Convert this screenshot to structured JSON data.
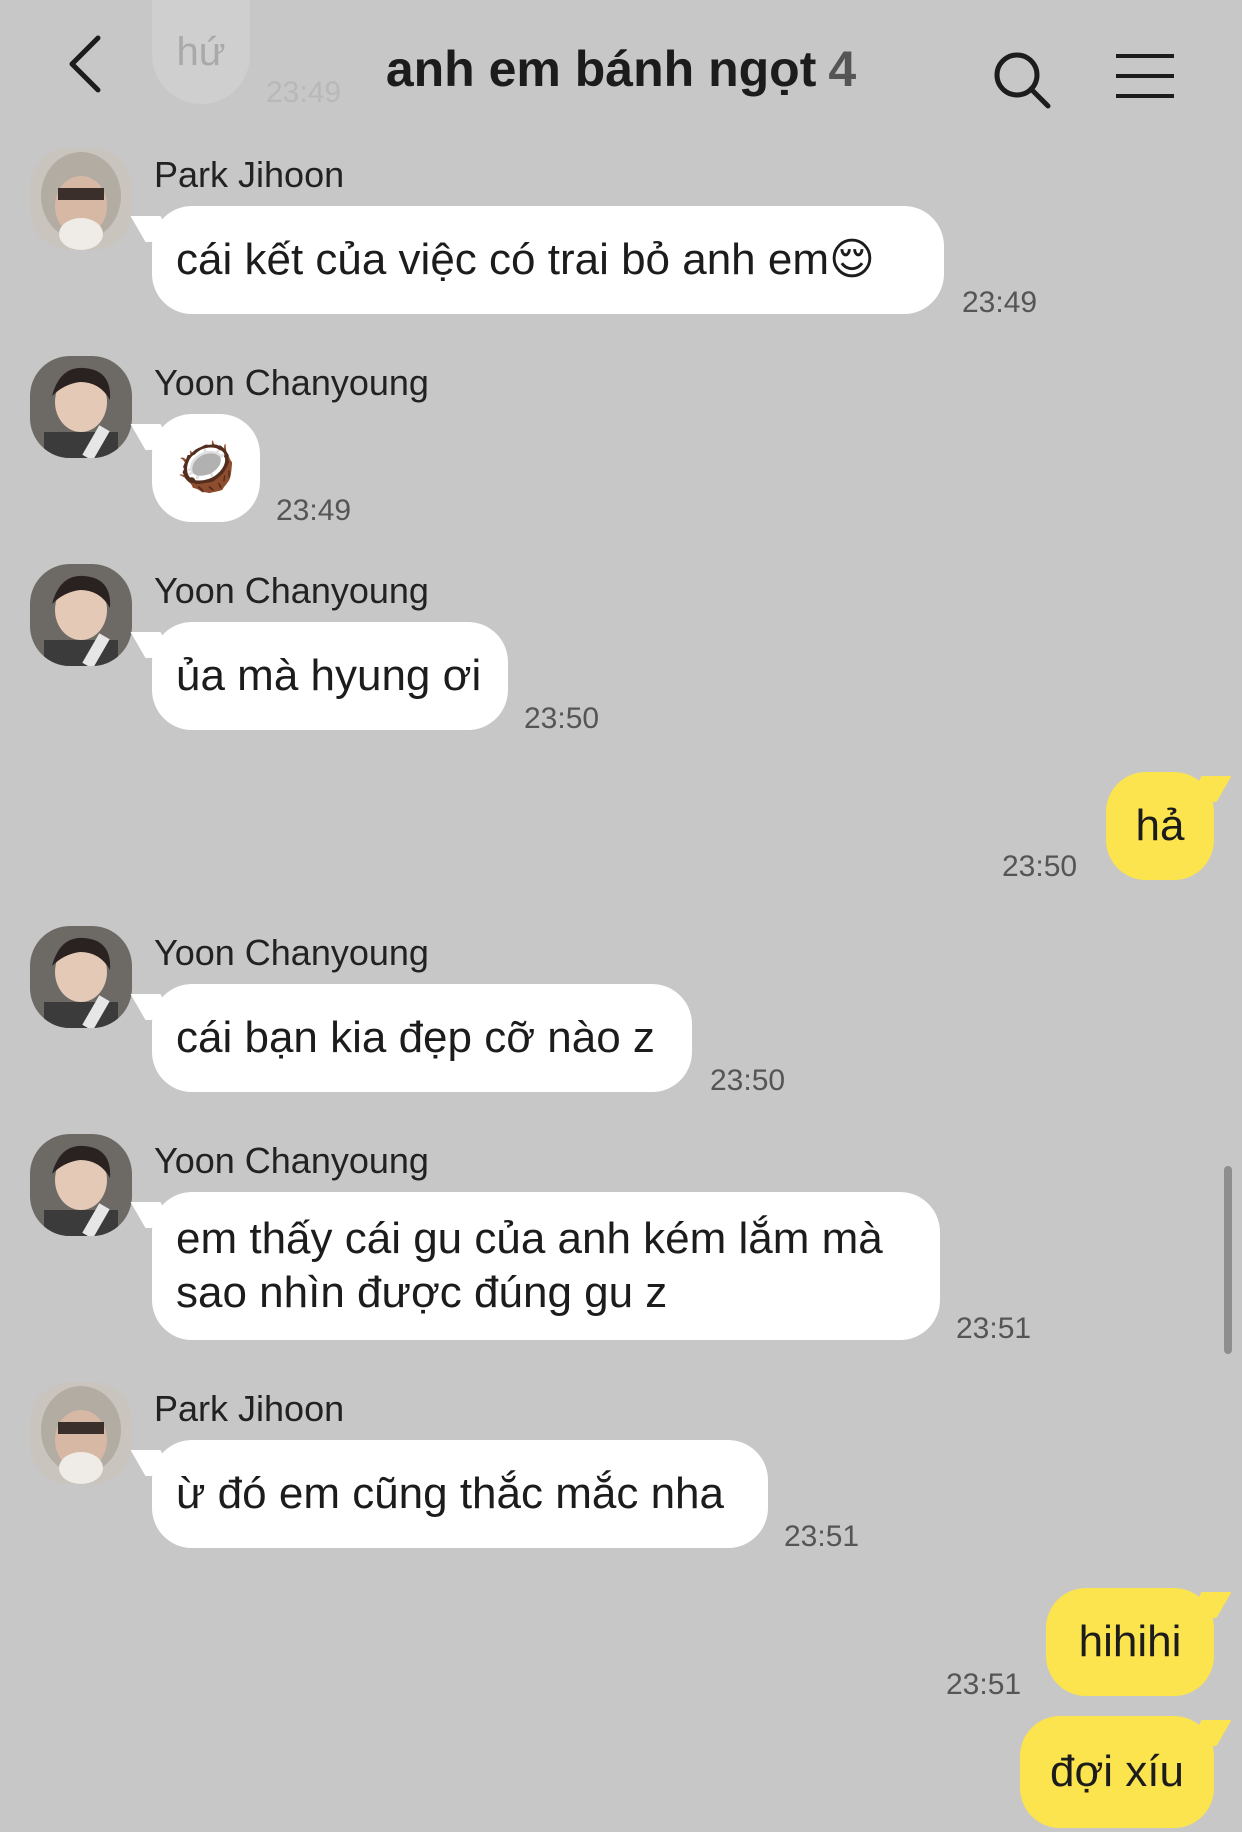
{
  "ghost": {
    "text": "hứ",
    "time": "23:49"
  },
  "header": {
    "title": "anh em bánh ngọt",
    "count": "4"
  },
  "messages": [
    {
      "sender": "Park Jihoon",
      "text": "cái kết của việc có trai bỏ anh em😌",
      "time": "23:49"
    },
    {
      "sender": "Yoon Chanyoung",
      "text": "🥥",
      "time": "23:49"
    },
    {
      "sender": "Yoon Chanyoung",
      "text": "ủa mà hyung ơi",
      "time": "23:50"
    },
    {
      "text": "hả",
      "time": "23:50"
    },
    {
      "sender": "Yoon Chanyoung",
      "text": "cái bạn kia đẹp cỡ nào z",
      "time": "23:50"
    },
    {
      "sender": "Yoon Chanyoung",
      "line1": "em thấy cái gu của anh kém lắm mà",
      "line2": "sao nhìn được đúng gu z",
      "time": "23:51"
    },
    {
      "sender": "Park Jihoon",
      "text": "ừ đó em cũng thắc mắc nha",
      "time": "23:51"
    },
    {
      "text": "hihihi",
      "time": "23:51"
    },
    {
      "text": "đợi xíu"
    }
  ],
  "icons": {
    "back": "chevron-left-icon",
    "search": "search-icon",
    "menu": "hamburger-menu-icon"
  },
  "colors": {
    "background": "#c7c7c7",
    "incoming": "#ffffff",
    "outgoing": "#fbe44d"
  }
}
